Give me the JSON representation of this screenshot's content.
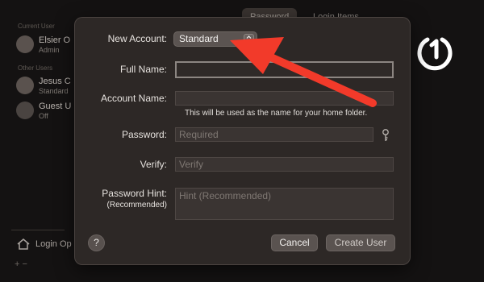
{
  "background": {
    "tabs": [
      "Password",
      "Login Items"
    ],
    "sections": [
      "Current User",
      "Other Users"
    ],
    "users": [
      {
        "name": "Elsier O",
        "role": "Admin"
      },
      {
        "name": "Jesus C",
        "role": "Standard"
      },
      {
        "name": "Guest U",
        "role": "Off"
      }
    ],
    "login_options": "Login Op",
    "bottom_controls": "+  −"
  },
  "dialog": {
    "new_account_label": "New Account:",
    "account_type": "Standard",
    "full_name_label": "Full Name:",
    "full_name_value": "",
    "account_name_label": "Account Name:",
    "account_name_value": "",
    "account_name_note": "This will be used as the name for your home folder.",
    "password_label": "Password:",
    "password_placeholder": "Required",
    "verify_label": "Verify:",
    "verify_placeholder": "Verify",
    "hint_label_line1": "Password Hint:",
    "hint_label_line2": "(Recommended)",
    "hint_placeholder": "Hint (Recommended)",
    "help_label": "?",
    "cancel_label": "Cancel",
    "create_label": "Create User"
  },
  "colors": {
    "annotation_arrow": "#f23a2a",
    "dialog_bg": "#2d2826"
  },
  "icons": {
    "logo": "power-one-logo-icon",
    "key": "key-icon",
    "popup": "stepper-arrows-icon"
  }
}
